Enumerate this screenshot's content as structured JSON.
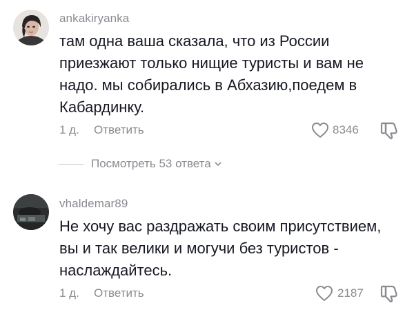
{
  "comments": [
    {
      "username": "ankakiryanka",
      "lines": [
        "там одна ваша сказала, что из России",
        "приезжают только нищие туристы и вам не",
        "надо. мы собирались в Абхазию,поедем в",
        "Кабардинку."
      ],
      "time": "1 д.",
      "reply_label": "Ответить",
      "likes": "8346",
      "avatar_icon": "user-avatar-photo"
    },
    {
      "username": "vhaldemar89",
      "lines": [
        "Не хочу вас раздражать своим присутствием,",
        "вы и так велики и могучи без туристов -",
        "наслаждайтесь."
      ],
      "time": "1 д.",
      "reply_label": "Ответить",
      "likes": "2187",
      "avatar_icon": "user-avatar-photo"
    }
  ],
  "view_replies": {
    "label": "Посмотреть 53 ответа",
    "icon": "chevron-down-icon"
  },
  "icons": {
    "like": "heart-outline-icon",
    "dislike": "thumbs-down-outline-icon"
  },
  "colors": {
    "text_primary": "#161823",
    "text_secondary": "#8a8b91"
  }
}
